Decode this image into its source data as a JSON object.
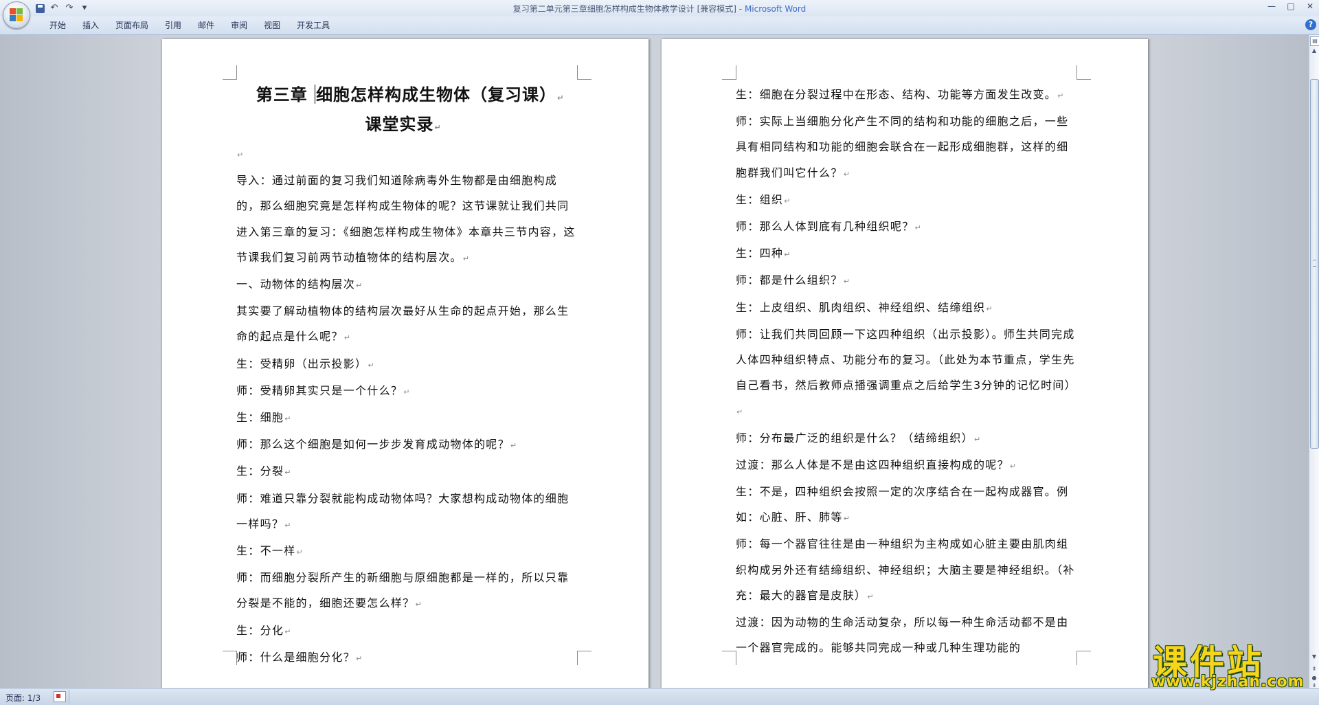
{
  "window": {
    "title": "复习第二单元第三章细胞怎样构成生物体教学设计 [兼容模式]",
    "app_name": "Microsoft Word",
    "controls": [
      "—",
      "□",
      "✕"
    ]
  },
  "qat": {
    "undo": "↶",
    "redo": "↷",
    "more": "▾"
  },
  "ribbon": {
    "tabs": [
      "开始",
      "插入",
      "页面布局",
      "引用",
      "邮件",
      "审阅",
      "视图",
      "开发工具"
    ],
    "help": "?"
  },
  "left_page": {
    "heading1": "第三章  细胞怎样构成生物体（复习课）",
    "heading1_pre": "第三章  ",
    "heading1_post": "细胞怎样构成生物体（复习课）",
    "heading2": "课堂实录",
    "paragraphs": [
      "导入：通过前面的复习我们知道除病毒外生物都是由细胞构成的，那么细胞究竟是怎样构成生物体的呢？这节课就让我们共同进入第三章的复习：《细胞怎样构成生物体》本章共三节内容，这节课我们复习前两节动植物体的结构层次。",
      "一、动物体的结构层次",
      "其实要了解动植物体的结构层次最好从生命的起点开始，那么生命的起点是什么呢？",
      "生：受精卵（出示投影）",
      "师：受精卵其实只是一个什么？",
      "生：细胞",
      "师：那么这个细胞是如何一步步发育成动物体的呢？",
      "生：分裂",
      "师：难道只靠分裂就能构成动物体吗？大家想构成动物体的细胞一样吗？",
      "生：不一样",
      "师：而细胞分裂所产生的新细胞与原细胞都是一样的，所以只靠分裂是不能的，细胞还要怎么样？",
      "生：分化",
      "师：什么是细胞分化？"
    ]
  },
  "right_page": {
    "paragraphs": [
      "生：细胞在分裂过程中在形态、结构、功能等方面发生改变。",
      "师：实际上当细胞分化产生不同的结构和功能的细胞之后，一些具有相同结构和功能的细胞会联合在一起形成细胞群，这样的细胞群我们叫它什么？",
      "生：组织",
      "师：那么人体到底有几种组织呢？",
      "生：四种",
      "师：都是什么组织？",
      "生：上皮组织、肌肉组织、神经组织、结缔组织",
      "师：让我们共同回顾一下这四种组织（出示投影）。师生共同完成人体四种组织特点、功能分布的复习。（此处为本节重点，学生先自己看书，然后教师点播强调重点之后给学生3分钟的记忆时间）",
      "师：分布最广泛的组织是什么？（结缔组织）",
      "过渡：那么人体是不是由这四种组织直接构成的呢？",
      "生：不是，四种组织会按照一定的次序结合在一起构成器官。例如：心脏、肝、肺等",
      "师：每一个器官往往是由一种组织为主构成如心脏主要由肌肉组织构成另外还有结缔组织、神经组织；大脑主要是神经组织。（补充：最大的器官是皮肤）",
      "过渡：因为动物的生命活动复杂，所以每一种生命活动都不是由一个器官完成的。能够共同完成一种或几种生理功能的"
    ]
  },
  "paragraph_mark": "↵",
  "status": {
    "page_info": "页面: 1/3"
  },
  "watermark": {
    "title": "课件站",
    "url": "www.kjzhan.com"
  }
}
